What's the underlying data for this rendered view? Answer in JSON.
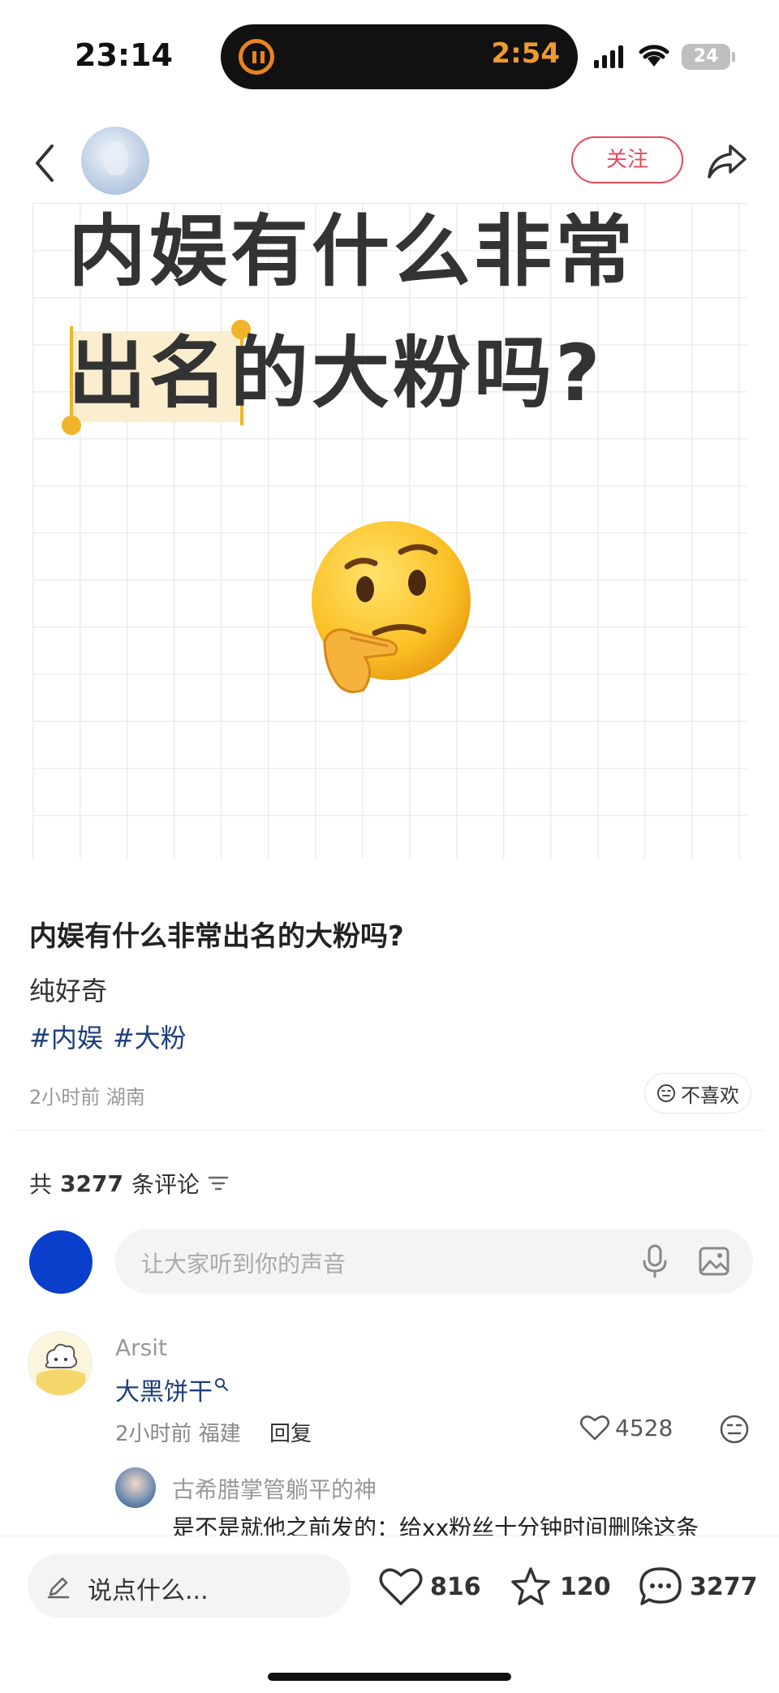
{
  "status_bar": {
    "time": "23:14",
    "island_time": "2:54",
    "battery": "24"
  },
  "header": {
    "follow_label": "关注"
  },
  "hero": {
    "line1": "内娱有什么非常",
    "line2": "出名的大粉吗?",
    "emoji_icon": "thinking-face-emoji"
  },
  "post": {
    "title": "内娱有什么非常出名的大粉吗?",
    "body": "纯好奇",
    "tags": [
      "#内娱",
      "#大粉"
    ],
    "meta": "2小时前 湖南",
    "dislike_label": "不喜欢"
  },
  "comments_section": {
    "count_prefix": "共",
    "count": "3277",
    "count_suffix": "条评论",
    "input_placeholder": "让大家听到你的声音"
  },
  "comment": {
    "user": "Arsit",
    "text": "大黑饼干",
    "meta": "2小时前 福建",
    "reply_label": "回复",
    "likes": "4528"
  },
  "reply": {
    "user": "古希腊掌管躺平的神",
    "text": "是不是就他之前发的：给xx粉丝十分钟时间删除这条"
  },
  "bottom_bar": {
    "say_placeholder": "说点什么...",
    "likes": "816",
    "favorites": "120",
    "comments": "3277"
  },
  "colors": {
    "accent_red": "#e8485a",
    "tag_blue": "#1d3f7a",
    "highlight_yellow": "#f0b429"
  }
}
